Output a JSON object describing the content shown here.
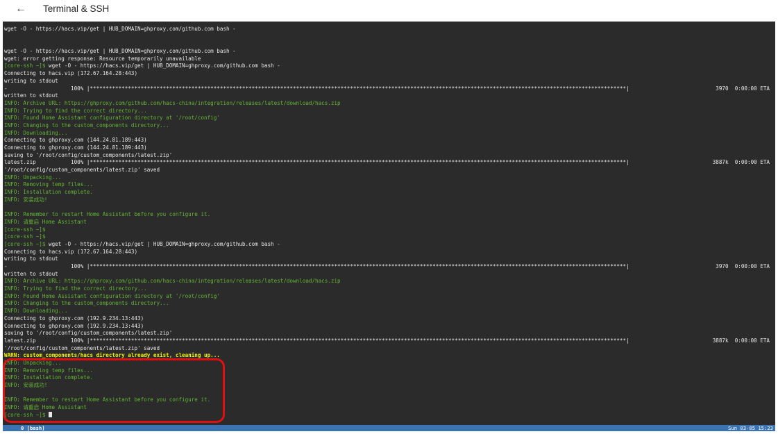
{
  "header": {
    "back_icon": "arrow-left-icon",
    "title": "Terminal & SSH"
  },
  "terminal": {
    "lines": [
      {
        "type": "plain",
        "text": "wget -O - https://hacs.vip/get | HUB_DOMAIN=ghproxy.com/github.com bash -"
      },
      {
        "type": "plain",
        "text": ""
      },
      {
        "type": "plain",
        "text": ""
      },
      {
        "type": "plain",
        "text": "wget -O - https://hacs.vip/get | HUB_DOMAIN=ghproxy.com/github.com bash -"
      },
      {
        "type": "plain",
        "text": "wget: error getting response: Resource temporarily unavailable"
      },
      {
        "type": "prompt",
        "prompt": "[core-ssh ~]$ ",
        "text": "wget -O - https://hacs.vip/get | HUB_DOMAIN=ghproxy.com/github.com bash -"
      },
      {
        "type": "plain",
        "text": "Connecting to hacs.vip (172.67.164.28:443)"
      },
      {
        "type": "plain",
        "text": "writing to stdout"
      },
      {
        "type": "progress",
        "text": "-                    100% |*************************************************************************************************************************************************************************|",
        "right": "3970  0:00:00 ETA"
      },
      {
        "type": "plain",
        "text": "written to stdout"
      },
      {
        "type": "info",
        "text": "INFO: Archive URL: https://ghproxy.com/github.com/hacs-china/integration/releases/latest/download/hacs.zip"
      },
      {
        "type": "info",
        "text": "INFO: Trying to find the correct directory..."
      },
      {
        "type": "info",
        "text": "INFO: Found Home Assistant configuration directory at '/root/config'"
      },
      {
        "type": "info",
        "text": "INFO: Changing to the custom_components directory..."
      },
      {
        "type": "info",
        "text": "INFO: Downloading..."
      },
      {
        "type": "plain",
        "text": "Connecting to ghproxy.com (144.24.81.189:443)"
      },
      {
        "type": "plain",
        "text": "Connecting to ghproxy.com (144.24.81.189:443)"
      },
      {
        "type": "plain",
        "text": "saving to '/root/config/custom_components/latest.zip'"
      },
      {
        "type": "progress",
        "text": "latest.zip           100% |*************************************************************************************************************************************************************************|",
        "right": "3887k  0:00:00 ETA"
      },
      {
        "type": "plain",
        "text": "'/root/config/custom_components/latest.zip' saved"
      },
      {
        "type": "info",
        "text": "INFO: Unpacking..."
      },
      {
        "type": "info",
        "text": "INFO: Removing temp files..."
      },
      {
        "type": "info",
        "text": "INFO: Installation complete."
      },
      {
        "type": "info",
        "text": "INFO: 安装成功!"
      },
      {
        "type": "plain",
        "text": ""
      },
      {
        "type": "info",
        "text": "INFO: Remember to restart Home Assistant before you configure it."
      },
      {
        "type": "info",
        "text": "INFO: 请重启 Home Assistant"
      },
      {
        "type": "prompt",
        "prompt": "[core-ssh ~]$",
        "text": ""
      },
      {
        "type": "prompt",
        "prompt": "[core-ssh ~]$",
        "text": ""
      },
      {
        "type": "prompt",
        "prompt": "[core-ssh ~]$ ",
        "text": "wget -O - https://hacs.vip/get | HUB_DOMAIN=ghproxy.com/github.com bash -"
      },
      {
        "type": "plain",
        "text": "Connecting to hacs.vip (172.67.164.28:443)"
      },
      {
        "type": "plain",
        "text": "writing to stdout"
      },
      {
        "type": "progress",
        "text": "-                    100% |*************************************************************************************************************************************************************************|",
        "right": "3970  0:00:00 ETA"
      },
      {
        "type": "plain",
        "text": "written to stdout"
      },
      {
        "type": "info",
        "text": "INFO: Archive URL: https://ghproxy.com/github.com/hacs-china/integration/releases/latest/download/hacs.zip"
      },
      {
        "type": "info",
        "text": "INFO: Trying to find the correct directory..."
      },
      {
        "type": "info",
        "text": "INFO: Found Home Assistant configuration directory at '/root/config'"
      },
      {
        "type": "info",
        "text": "INFO: Changing to the custom_components directory..."
      },
      {
        "type": "info",
        "text": "INFO: Downloading..."
      },
      {
        "type": "plain",
        "text": "Connecting to ghproxy.com (192.9.234.13:443)"
      },
      {
        "type": "plain",
        "text": "Connecting to ghproxy.com (192.9.234.13:443)"
      },
      {
        "type": "plain",
        "text": "saving to '/root/config/custom_components/latest.zip'"
      },
      {
        "type": "progress",
        "text": "latest.zip           100% |*************************************************************************************************************************************************************************|",
        "right": "3887k  0:00:00 ETA"
      },
      {
        "type": "plain",
        "text": "'/root/config/custom_components/latest.zip' saved"
      },
      {
        "type": "warn",
        "text": "WARN: custom_components/hacs directory already exist, cleaning up..."
      },
      {
        "type": "info",
        "text": "INFO: Unpacking..."
      },
      {
        "type": "info",
        "text": "INFO: Removing temp files..."
      },
      {
        "type": "info",
        "text": "INFO: Installation complete."
      },
      {
        "type": "info",
        "text": "INFO: 安装成功!"
      },
      {
        "type": "plain",
        "text": ""
      },
      {
        "type": "info",
        "text": "INFO: Remember to restart Home Assistant before you configure it."
      },
      {
        "type": "info",
        "text": "INFO: 请重启 Home Assistant"
      },
      {
        "type": "cursor",
        "prompt": "[core-ssh ~]$ ",
        "text": ""
      }
    ]
  },
  "statusbar": {
    "left": "0 [bash]",
    "right": "Sun 03-05 15:23"
  },
  "colors": {
    "terminal_bg": "#2b2b2b",
    "info_green": "#63b534",
    "warn_yellow": "#f2f200",
    "status_blue": "#3a73b0",
    "highlight_red": "#e01010"
  }
}
